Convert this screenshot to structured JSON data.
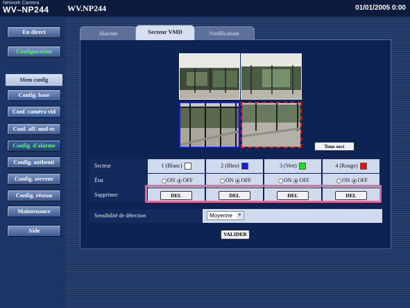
{
  "header": {
    "brand_small": "Network Camera",
    "brand_model": "WV–NP244",
    "page_title": "WV.NP244",
    "datetime": "01/01/2005  0:00"
  },
  "sidebar": {
    "live": "En direct",
    "config": "Configuration",
    "mem_config": "Mem config",
    "items": [
      "Config. base",
      "Conf. caméra vid",
      "Conf. aff. mul-éc",
      "Config. d'alarme",
      "Config. authenti",
      "Config. serveur",
      "Config. réseau",
      "Maintenance",
      "Aide"
    ]
  },
  "tabs": [
    "Alarme",
    "Secteur VMD",
    "Notification"
  ],
  "active_tab": "Secteur VMD",
  "buttons": {
    "tous": "Tous sect",
    "valider": "VALIDER"
  },
  "table": {
    "row_labels": {
      "secteur": "Secteur",
      "etat": "État",
      "supprimer": "Supprimer"
    },
    "sectors": [
      {
        "label": "1 (Blanc)",
        "color": "#ffffff",
        "on": "ON",
        "off": "OFF",
        "selected": "OFF",
        "del": "DEL"
      },
      {
        "label": "2 (Bleu)",
        "color": "#1818e6",
        "on": "ON",
        "off": "OFF",
        "selected": "OFF",
        "del": "DEL"
      },
      {
        "label": "3 (Vert)",
        "color": "#19e619",
        "on": "ON",
        "off": "OFF",
        "selected": "OFF",
        "del": "DEL"
      },
      {
        "label": "4 (Rouge)",
        "color": "#ee1010",
        "on": "ON",
        "off": "OFF",
        "selected": "OFF",
        "del": "DEL"
      }
    ]
  },
  "sensitivity": {
    "label": "Sensibilité de détection",
    "value": "Moyenne"
  }
}
